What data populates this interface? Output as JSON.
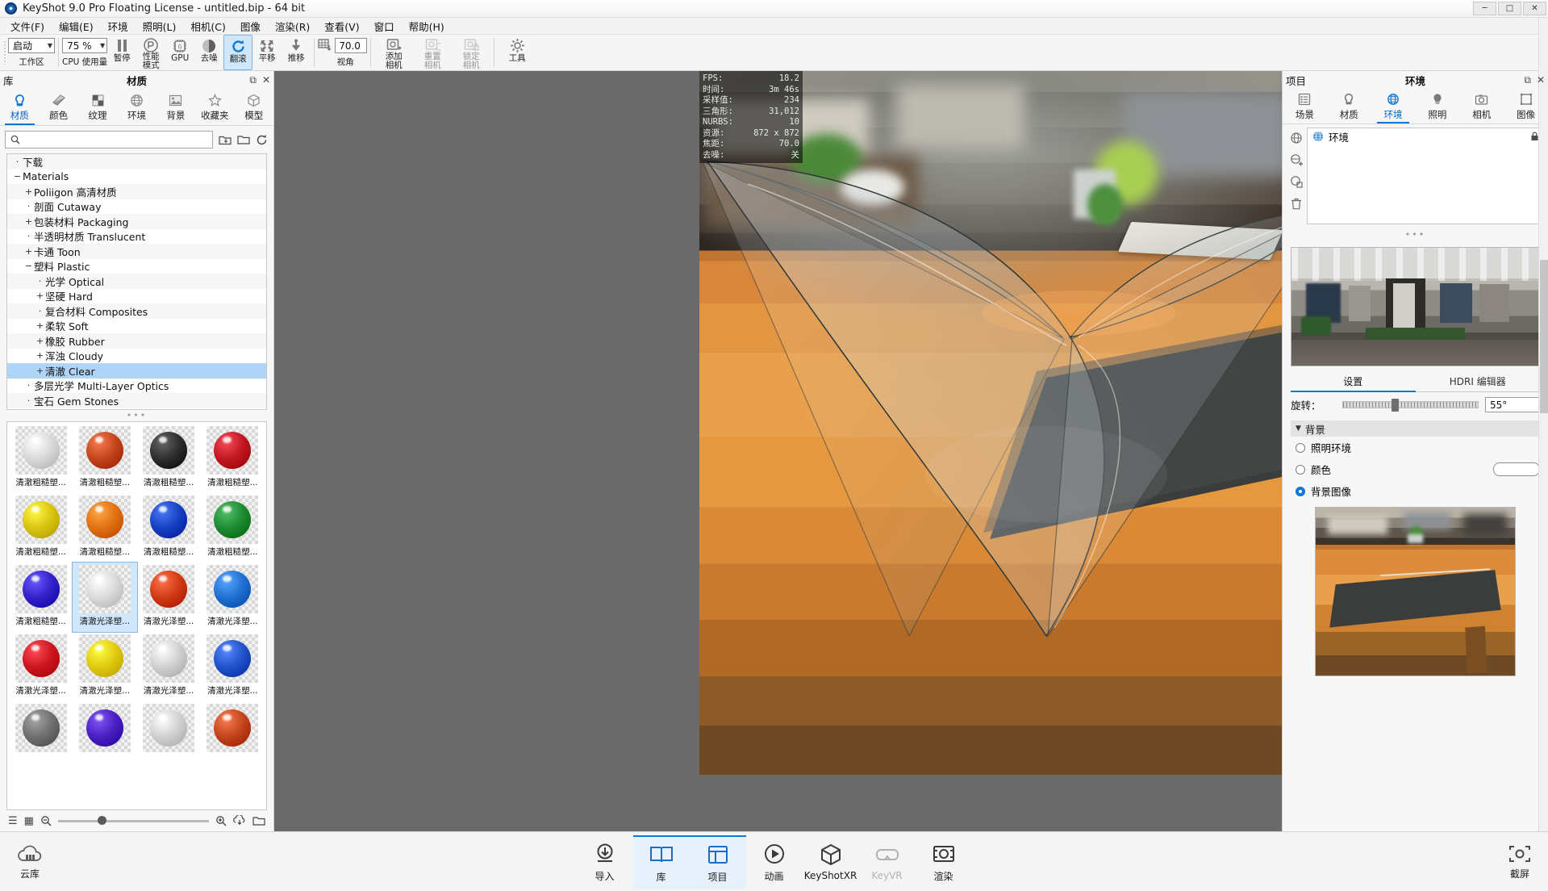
{
  "window": {
    "title": "KeyShot 9.0 Pro Floating License  - untitled.bip  - 64 bit",
    "minimize": "─",
    "maximize": "□",
    "close": "✕"
  },
  "menubar": {
    "items": [
      {
        "label": "文件(F)"
      },
      {
        "label": "编辑(E)"
      },
      {
        "label": "环境"
      },
      {
        "label": "照明(L)"
      },
      {
        "label": "相机(C)"
      },
      {
        "label": "图像"
      },
      {
        "label": "渲染(R)"
      },
      {
        "label": "查看(V)"
      },
      {
        "label": "窗口"
      },
      {
        "label": "帮助(H)"
      }
    ]
  },
  "toolbar": {
    "workspace_value": "启动",
    "workspace_label": "工作区",
    "cpu_value": "75 %",
    "cpu_label": "CPU 使用量",
    "pause_label": "暂停",
    "performance_label": "性能\n模式",
    "performance_label_1": "性能",
    "performance_label_2": "模式",
    "gpu_label": "GPU",
    "denoise_label": "去噪",
    "tumble_label": "翻滚",
    "pan_label": "平移",
    "dolly_label": "推移",
    "fov_value": "70.0",
    "fov_label": "视角",
    "add_camera_label_1": "添加",
    "add_camera_label_2": "相机",
    "reset_camera_label_1": "重置",
    "reset_camera_label_2": "相机",
    "lock_camera_label_1": "锁定",
    "lock_camera_label_2": "相机",
    "tools_label": "工具"
  },
  "library": {
    "header_left": "库",
    "header_center": "材质",
    "undock_icon": "⧉",
    "close_icon": "✕",
    "tabs": [
      {
        "label": "材质",
        "icon": "material-icon",
        "selected": true
      },
      {
        "label": "颜色",
        "icon": "color-icon",
        "selected": false
      },
      {
        "label": "纹理",
        "icon": "texture-icon",
        "selected": false
      },
      {
        "label": "环境",
        "icon": "environment-icon",
        "selected": false
      },
      {
        "label": "背景",
        "icon": "backplate-icon",
        "selected": false
      },
      {
        "label": "收藏夹",
        "icon": "star-icon",
        "selected": false
      },
      {
        "label": "模型",
        "icon": "model-icon",
        "selected": false
      }
    ],
    "search_placeholder": "",
    "search_value": "",
    "tree": [
      {
        "label": "下载",
        "depth": 0,
        "expander": "·",
        "selected": false
      },
      {
        "label": "Materials",
        "depth": 0,
        "expander": "−",
        "selected": false
      },
      {
        "label": "Poliigon 高清材质",
        "depth": 1,
        "expander": "+",
        "selected": false
      },
      {
        "label": "剖面 Cutaway",
        "depth": 1,
        "expander": "·",
        "selected": false
      },
      {
        "label": "包装材料 Packaging",
        "depth": 1,
        "expander": "+",
        "selected": false
      },
      {
        "label": "半透明材质 Translucent",
        "depth": 1,
        "expander": "·",
        "selected": false
      },
      {
        "label": "卡通 Toon",
        "depth": 1,
        "expander": "+",
        "selected": false
      },
      {
        "label": "塑料 Plastic",
        "depth": 1,
        "expander": "−",
        "selected": false
      },
      {
        "label": "光学 Optical",
        "depth": 2,
        "expander": "·",
        "selected": false
      },
      {
        "label": "坚硬 Hard",
        "depth": 2,
        "expander": "+",
        "selected": false
      },
      {
        "label": "复合材料 Composites",
        "depth": 2,
        "expander": "·",
        "selected": false
      },
      {
        "label": "柔软 Soft",
        "depth": 2,
        "expander": "+",
        "selected": false
      },
      {
        "label": "橡胶 Rubber",
        "depth": 2,
        "expander": "+",
        "selected": false
      },
      {
        "label": "浑浊 Cloudy",
        "depth": 2,
        "expander": "+",
        "selected": false
      },
      {
        "label": "清澈 Clear",
        "depth": 2,
        "expander": "+",
        "selected": true
      },
      {
        "label": "多层光学 Multi-Layer Optics",
        "depth": 1,
        "expander": "·",
        "selected": false
      },
      {
        "label": "宝石 Gem Stones",
        "depth": 1,
        "expander": "·",
        "selected": false
      }
    ],
    "grid_dots": "•••",
    "materials": [
      {
        "caption": "清澈粗糙塑...",
        "color": "#d8d8d8",
        "selected": false
      },
      {
        "caption": "清澈粗糙塑...",
        "color": "#c2441a",
        "selected": false
      },
      {
        "caption": "清澈粗糙塑...",
        "color": "#2e2e2e",
        "selected": false
      },
      {
        "caption": "清澈粗糙塑...",
        "color": "#c01622",
        "selected": false
      },
      {
        "caption": "清澈粗糙塑...",
        "color": "#d8c310",
        "selected": false
      },
      {
        "caption": "清澈粗糙塑...",
        "color": "#e07010",
        "selected": false
      },
      {
        "caption": "清澈粗糙塑...",
        "color": "#1540c0",
        "selected": false
      },
      {
        "caption": "清澈粗糙塑...",
        "color": "#1d8a33",
        "selected": false
      },
      {
        "caption": "清澈粗糙塑...",
        "color": "#3320c8",
        "selected": false
      },
      {
        "caption": "清澈光泽塑...",
        "color": "#d9d9d9",
        "selected": true
      },
      {
        "caption": "清澈光泽塑...",
        "color": "#cf3a14",
        "selected": false
      },
      {
        "caption": "清澈光泽塑...",
        "color": "#1f6fd0",
        "selected": false
      },
      {
        "caption": "清澈光泽塑...",
        "color": "#cc1420",
        "selected": false
      },
      {
        "caption": "清澈光泽塑...",
        "color": "#e0c80e",
        "selected": false
      },
      {
        "caption": "清澈光泽塑...",
        "color": "#cfcfcf",
        "selected": false
      },
      {
        "caption": "清澈光泽塑...",
        "color": "#2152c9",
        "selected": false
      },
      {
        "caption": "",
        "color": "#6f6f6f",
        "selected": false
      },
      {
        "caption": "",
        "color": "#4a1fc0",
        "selected": false
      },
      {
        "caption": "",
        "color": "#d0d0d0",
        "selected": false
      },
      {
        "caption": "",
        "color": "#c2441a",
        "selected": false
      }
    ],
    "footer": {
      "list_view_icon": "☰",
      "grid_view_icon": "▦",
      "zoom_out_icon": "zoom-out-icon",
      "zoom_in_icon": "zoom-in-icon",
      "import_icon": "import-icon",
      "folder_icon": "folder-icon"
    }
  },
  "hud": {
    "rows": [
      {
        "key": "FPS:",
        "value": "18.2"
      },
      {
        "key": "时间:",
        "value": "3m 46s"
      },
      {
        "key": "采样值:",
        "value": "234"
      },
      {
        "key": "三角形:",
        "value": "31,012"
      },
      {
        "key": "NURBS:",
        "value": "10"
      },
      {
        "key": "资源:",
        "value": "872 x 872"
      },
      {
        "key": "焦距:",
        "value": "70.0"
      },
      {
        "key": "去噪:",
        "value": "关"
      }
    ]
  },
  "project": {
    "header_left": "项目",
    "header_center": "环境",
    "undock_icon": "⧉",
    "close_icon": "✕",
    "tabs": [
      {
        "label": "场景",
        "icon": "scene-icon",
        "selected": false
      },
      {
        "label": "材质",
        "icon": "material-icon",
        "selected": false
      },
      {
        "label": "环境",
        "icon": "environment-icon",
        "selected": true
      },
      {
        "label": "照明",
        "icon": "lighting-icon",
        "selected": false
      },
      {
        "label": "相机",
        "icon": "camera-icon",
        "selected": false
      },
      {
        "label": "图像",
        "icon": "image-icon",
        "selected": false
      }
    ],
    "side_tools": [
      {
        "icon": "environment-globe-icon"
      },
      {
        "icon": "add-environment-icon"
      },
      {
        "icon": "duplicate-environment-icon"
      },
      {
        "icon": "delete-icon"
      }
    ],
    "env_list": [
      {
        "label": "环境",
        "icon": "environment-icon",
        "lock": "🔒"
      }
    ],
    "dots": "•••",
    "env_tabs": [
      {
        "label": "设置",
        "selected": true
      },
      {
        "label": "HDRI 编辑器",
        "selected": false
      }
    ],
    "rotation": {
      "label": "旋转：",
      "value": "55°",
      "knob_percent": 36
    },
    "background": {
      "section_label": "背景",
      "triangle": "▼",
      "options": [
        {
          "label": "照明环境",
          "selected": false,
          "has_color": false
        },
        {
          "label": "颜色",
          "selected": false,
          "has_color": true
        },
        {
          "label": "背景图像",
          "selected": true,
          "has_color": false
        }
      ]
    }
  },
  "bottombar": {
    "left": {
      "label": "云库",
      "icon": "cloud-library-icon"
    },
    "right": {
      "label": "截屏",
      "icon": "screenshot-icon"
    },
    "items": [
      {
        "label": "导入",
        "icon": "import-icon",
        "state": "normal"
      },
      {
        "label": "库",
        "icon": "library-icon",
        "state": "active"
      },
      {
        "label": "项目",
        "icon": "project-icon",
        "state": "active"
      },
      {
        "label": "动画",
        "icon": "animation-icon",
        "state": "normal"
      },
      {
        "label": "KeyShotXR",
        "icon": "keyshotxr-icon",
        "state": "normal"
      },
      {
        "label": "KeyVR",
        "icon": "keyvr-icon",
        "state": "dim"
      },
      {
        "label": "渲染",
        "icon": "render-icon",
        "state": "normal"
      }
    ]
  },
  "colors": {
    "accent": "#1177d6",
    "selection": "#aed5f5",
    "toolbar_active": "#cfe6fb",
    "viewport_bg": "#6a6a6a"
  }
}
